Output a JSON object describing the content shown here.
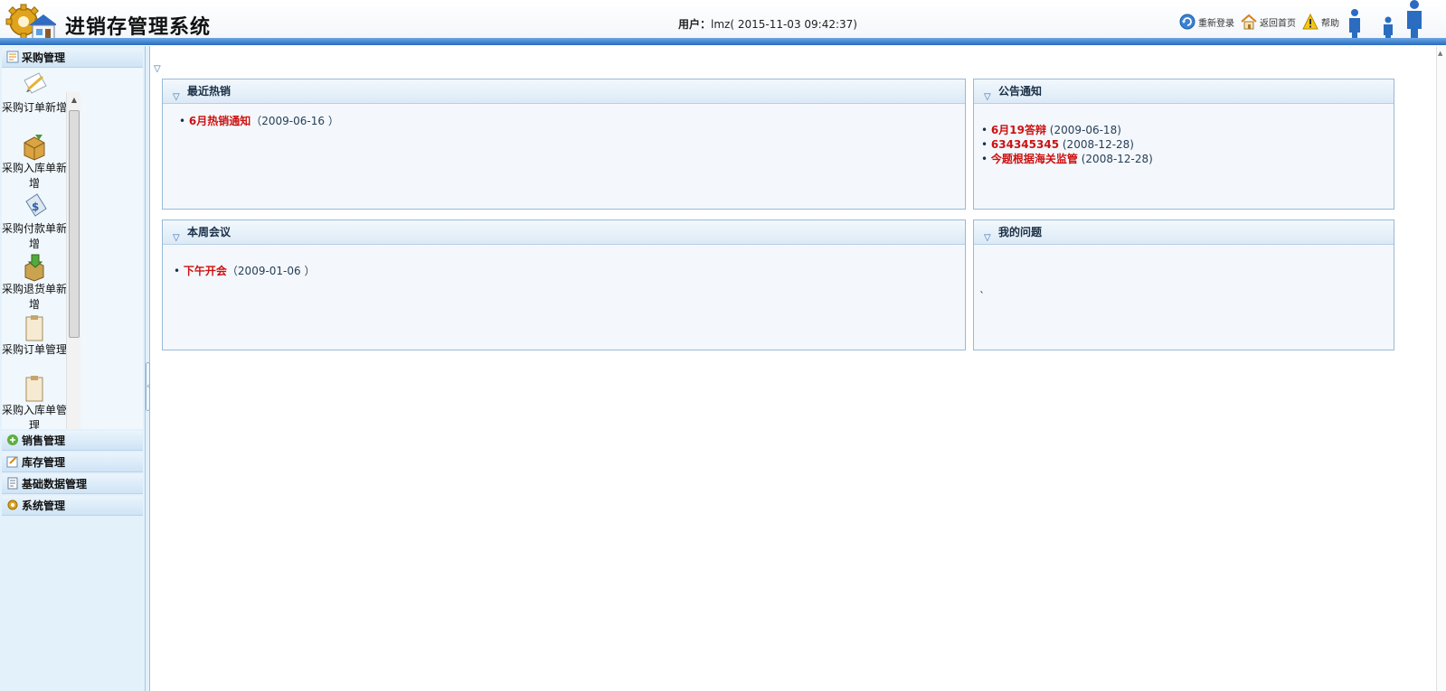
{
  "header": {
    "title": "进销存管理系统",
    "user_label": "用户：",
    "user_value": "lmz( 2015-11-03 09:42:37)",
    "links": [
      {
        "label": "重新登录",
        "icon": "refresh-icon"
      },
      {
        "label": "返回首页",
        "icon": "home-icon"
      },
      {
        "label": "帮助",
        "icon": "warning-icon"
      }
    ]
  },
  "sidebar": {
    "sections": [
      {
        "label": "采购管理",
        "icon": "purchase-icon",
        "expanded": true
      },
      {
        "label": "销售管理",
        "icon": "sales-icon"
      },
      {
        "label": "库存管理",
        "icon": "inventory-icon"
      },
      {
        "label": "基础数据管理",
        "icon": "basedata-icon"
      },
      {
        "label": "系统管理",
        "icon": "gear-icon"
      }
    ],
    "purchase_items": [
      {
        "label": "采购订单新增",
        "icon": "pencil-doc-icon"
      },
      {
        "label": "采购入库单新增",
        "icon": "box-icon"
      },
      {
        "label": "采购付款单新增",
        "icon": "money-tag-icon"
      },
      {
        "label": "采购退货单新增",
        "icon": "return-icon"
      },
      {
        "label": "采购订单管理",
        "icon": "clipboard-icon"
      },
      {
        "label": "采购入库单管理",
        "icon": "clipboard-icon"
      }
    ]
  },
  "main": {
    "panels": {
      "hot_sales": {
        "title": "最近热销",
        "items": [
          {
            "text": "6月热销通知",
            "date": "（2009-06-16 ）"
          }
        ]
      },
      "notices": {
        "title": "公告通知",
        "items": [
          {
            "text": "6月19答辩",
            "date": " (2009-06-18)"
          },
          {
            "text": "634345345",
            "date": " (2008-12-28)"
          },
          {
            "text": "今题根据海关监管",
            "date": " (2008-12-28)"
          }
        ]
      },
      "meetings": {
        "title": "本周会议",
        "items": [
          {
            "text": "下午开会",
            "date": "（2009-01-06 ）"
          }
        ]
      },
      "my_questions": {
        "title": "我的问题",
        "body_mark": "`"
      }
    }
  },
  "colors": {
    "header_bar": "#2a6cc0",
    "sidebar_bg": "#e3f1fb",
    "link_red": "#cc1111"
  }
}
